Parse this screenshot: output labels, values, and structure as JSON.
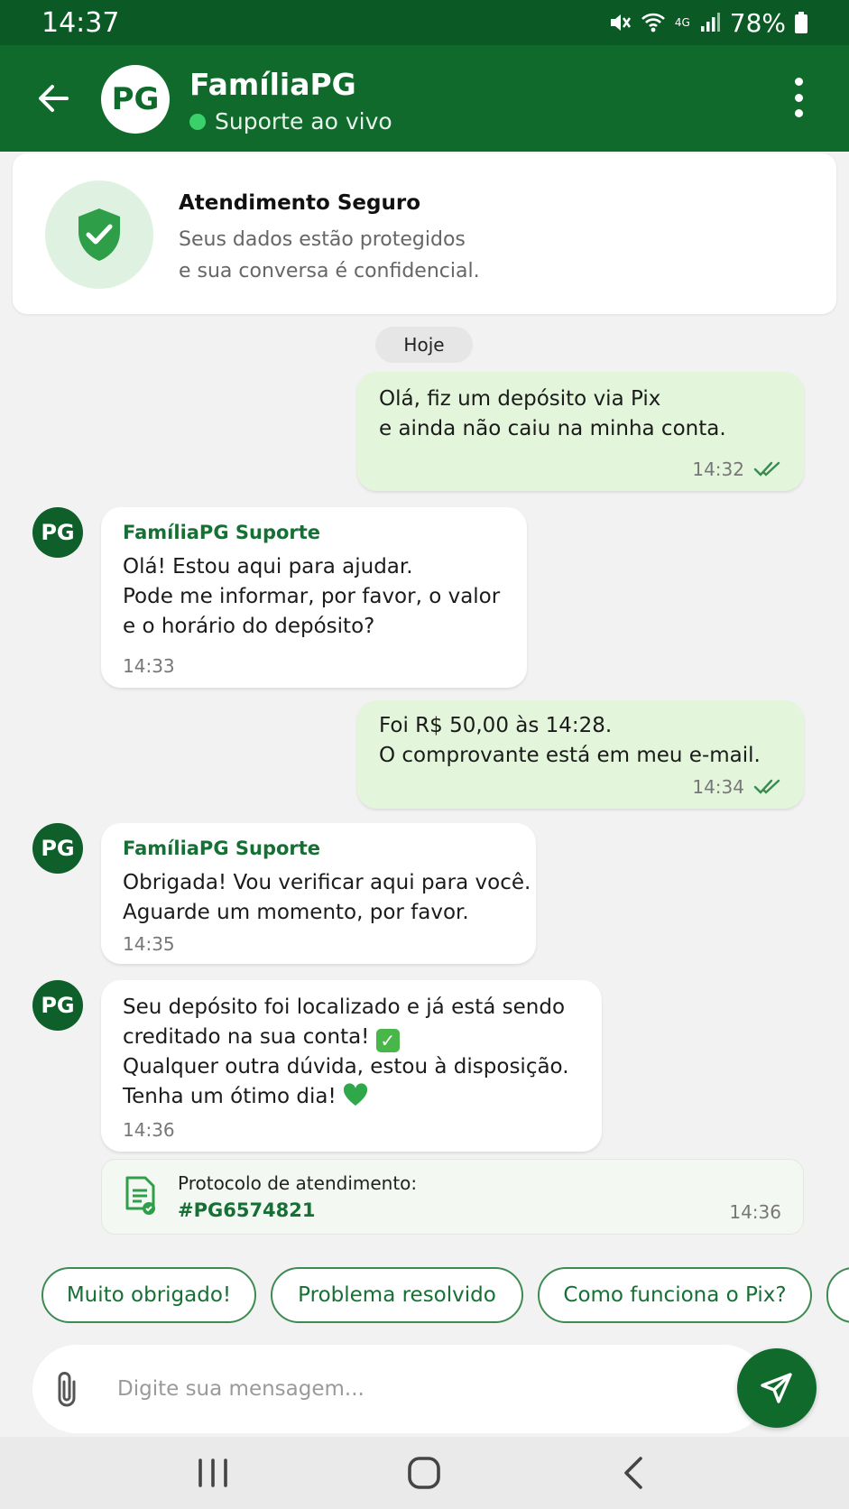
{
  "status_bar": {
    "time": "14:37",
    "battery": "78%",
    "network": "4G"
  },
  "header": {
    "avatar_initials": "PG",
    "title": "FamíliaPG",
    "status": "Suporte ao vivo"
  },
  "secure_card": {
    "title": "Atendimento Seguro",
    "lines": [
      "Seus dados estão protegidos",
      "e sua conversa é confidencial."
    ]
  },
  "day_label": "Hoje",
  "messages": [
    {
      "direction": "outgoing",
      "lines": [
        "Olá, fiz um depósito via Pix",
        "e ainda não caiu na minha conta."
      ],
      "time": "14:32"
    },
    {
      "direction": "incoming",
      "sender": "FamíliaPG Suporte",
      "avatar": "PG",
      "lines": [
        "Olá! Estou aqui para ajudar.",
        "Pode me informar, por favor, o valor",
        "e o horário do depósito?"
      ],
      "time": "14:33"
    },
    {
      "direction": "outgoing",
      "lines": [
        "Foi R$ 50,00 às 14:28.",
        "O comprovante está em meu e-mail."
      ],
      "time": "14:34"
    },
    {
      "direction": "incoming",
      "sender": "FamíliaPG Suporte",
      "avatar": "PG",
      "lines": [
        "Obrigada! Vou verificar aqui para você.",
        "Aguarde um momento, por favor."
      ],
      "time": "14:35"
    },
    {
      "direction": "incoming",
      "avatar": "PG",
      "lines": [
        "Seu depósito foi localizado e já está sendo",
        "creditado na sua conta!",
        "Qualquer outra dúvida, estou à disposição.",
        "Tenha um ótimo dia!"
      ],
      "time": "14:36"
    }
  ],
  "protocol": {
    "label": "Protocolo de atendimento:",
    "code": "#PG6574821",
    "time": "14:36"
  },
  "quick_replies": [
    "Muito obrigado!",
    "Problema resolvido",
    "Como funciona o Pix?"
  ],
  "composer": {
    "placeholder": "Digite sua mensagem..."
  },
  "colors": {
    "brand": "#0f6a2c",
    "status_bar": "#0b5a26",
    "outgoing_bubble": "#e3f6db",
    "accent_text": "#167035",
    "online": "#3bd16a"
  },
  "icons": [
    "back-arrow-icon",
    "more-vert-icon",
    "shield-check-icon",
    "double-check-icon",
    "document-icon",
    "paperclip-icon",
    "send-icon"
  ]
}
